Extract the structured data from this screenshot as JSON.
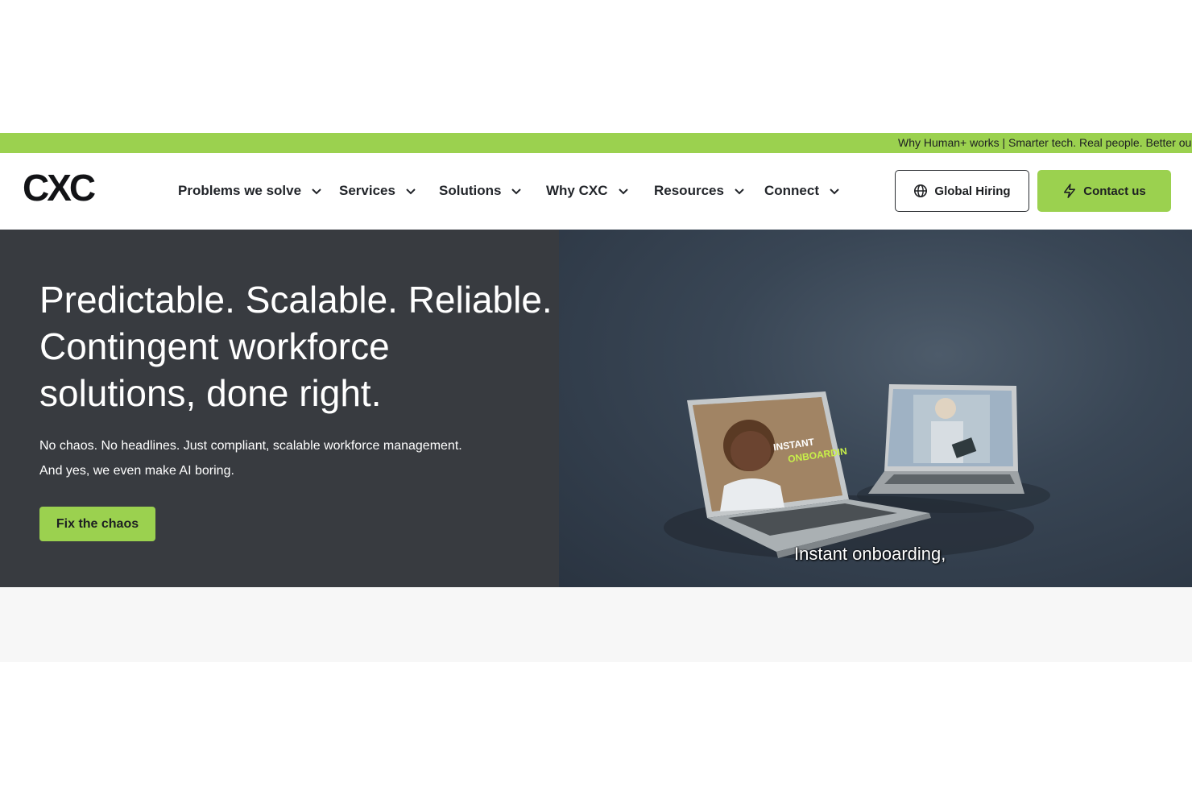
{
  "ticker": {
    "text": "Why Human+ works | Smarter tech. Real people. Better ou"
  },
  "header": {
    "logo_text": "CXC",
    "nav": [
      {
        "label": "Problems we solve"
      },
      {
        "label": "Services"
      },
      {
        "label": "Solutions"
      },
      {
        "label": "Why CXC"
      },
      {
        "label": "Resources"
      },
      {
        "label": "Connect"
      }
    ],
    "global_hiring_label": "Global Hiring",
    "contact_label": "Contact us"
  },
  "hero": {
    "title_lines": [
      "Predictable. Scalable. Reliable.",
      "Contingent workforce",
      "solutions, done right."
    ],
    "subtitle_lines": [
      "No chaos. No headlines. Just compliant, scalable workforce management.",
      "And yes, we even make AI boring."
    ],
    "cta_label": "Fix the chaos",
    "video": {
      "overlay_line1": "INSTANT",
      "overlay_line2": "ONBOARDIN",
      "caption": "Instant onboarding,"
    }
  },
  "colors": {
    "accent_green": "#9bd14f",
    "hero_dark": "#383b40",
    "text_dark": "#1d1f22"
  },
  "icons": {
    "globe": "globe-icon",
    "bolt": "lightning-icon",
    "chevron": "chevron-down-icon"
  }
}
